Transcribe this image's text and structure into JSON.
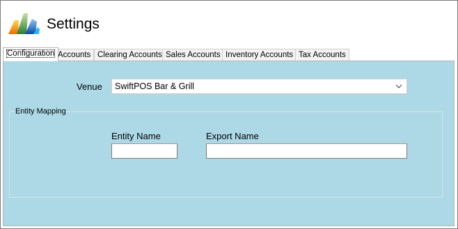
{
  "window": {
    "title": "Settings"
  },
  "tabs": [
    {
      "label": "Configuration",
      "active": true
    },
    {
      "label": "Accounts"
    },
    {
      "label": "Clearing Accounts"
    },
    {
      "label": "Sales Accounts"
    },
    {
      "label": "Inventory Accounts"
    },
    {
      "label": "Tax Accounts"
    }
  ],
  "configuration": {
    "venue_label": "Venue",
    "venue_value": "SwiftPOS Bar & Grill",
    "entity_mapping": {
      "legend": "Entity Mapping",
      "entity_name_label": "Entity Name",
      "entity_name_value": "",
      "export_name_label": "Export Name",
      "export_name_value": ""
    }
  },
  "colors": {
    "panel_background": "#add8e6",
    "logo_orange": "#f5a623",
    "logo_green": "#7cb342",
    "logo_blue": "#1e88e5"
  },
  "icons": {
    "logo": "dynamics-logo-icon",
    "dropdown": "chevron-down-icon"
  }
}
